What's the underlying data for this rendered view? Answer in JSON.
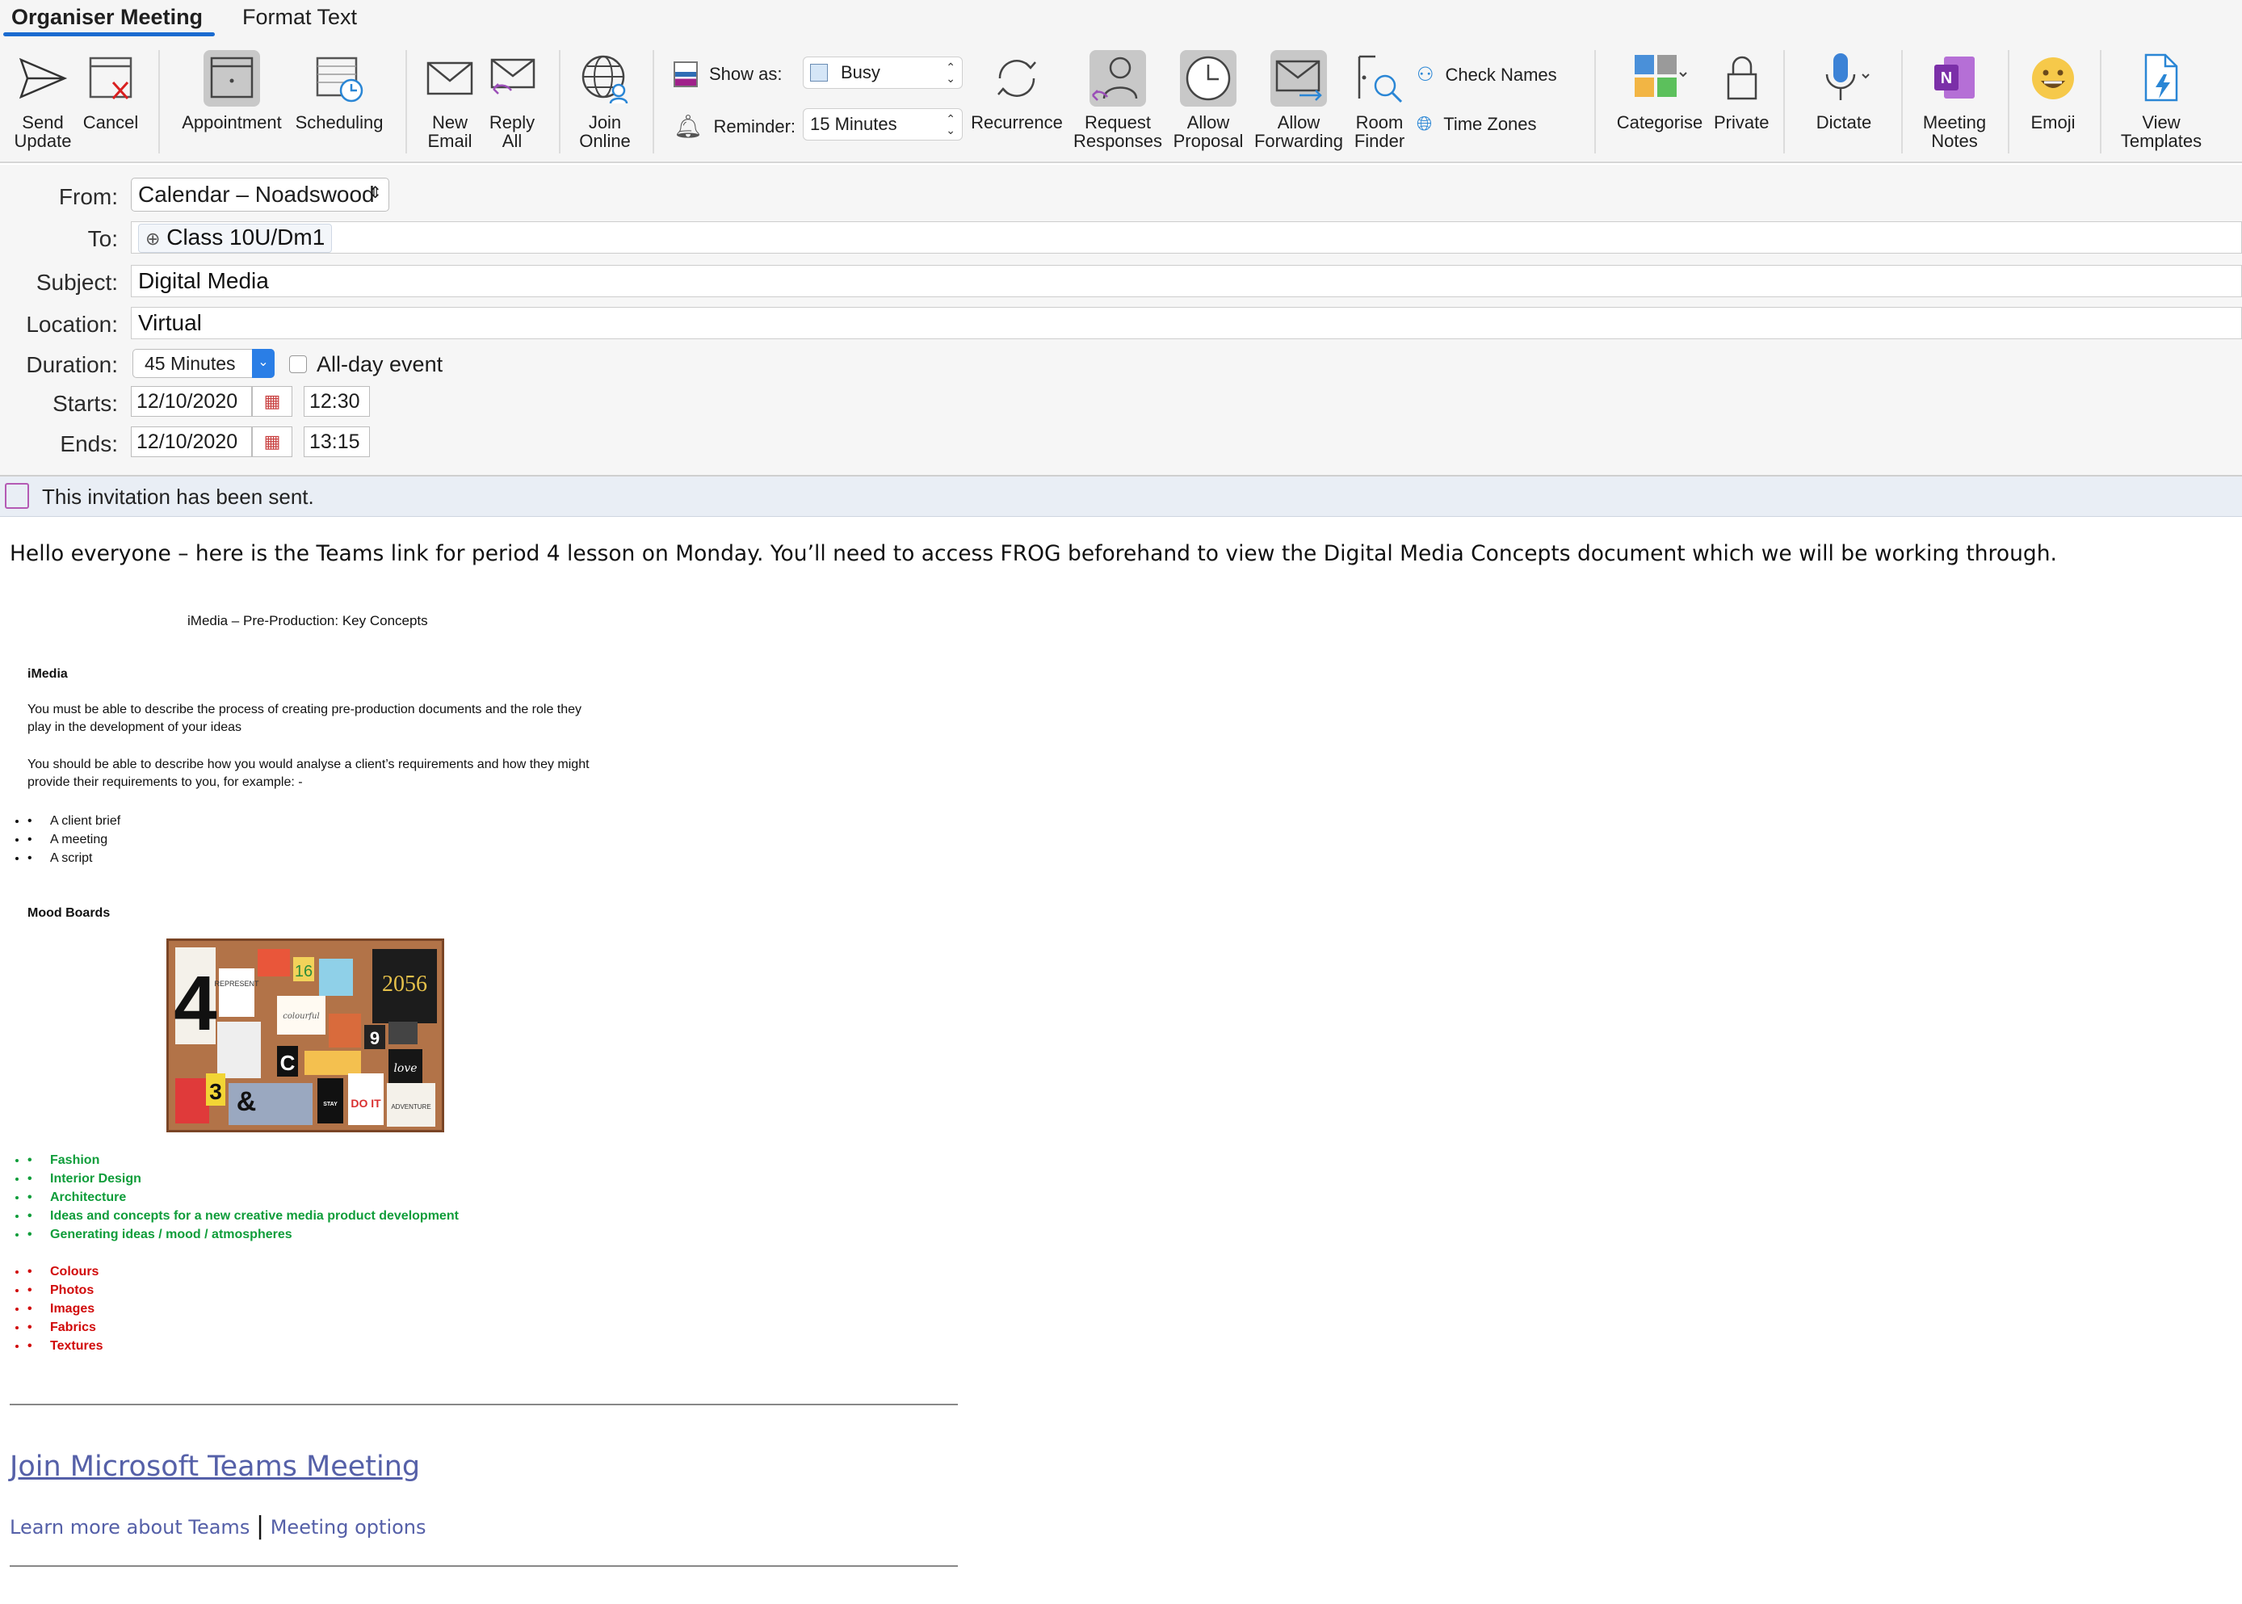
{
  "tabs": {
    "organiser": "Organiser Meeting",
    "format_text": "Format Text"
  },
  "ribbon": {
    "send_update": "Send\nUpdate",
    "cancel": "Cancel",
    "appointment": "Appointment",
    "scheduling": "Scheduling",
    "new_email": "New\nEmail",
    "reply_all": "Reply\nAll",
    "join_online": "Join\nOnline",
    "show_as_label": "Show as:",
    "show_as_value": "Busy",
    "reminder_label": "Reminder:",
    "reminder_value": "15 Minutes",
    "recurrence": "Recurrence",
    "request_responses": "Request\nResponses",
    "allow_proposal": "Allow\nProposal",
    "allow_forwarding": "Allow\nForwarding",
    "room_finder": "Room\nFinder",
    "check_names": "Check Names",
    "time_zones": "Time Zones",
    "categorise": "Categorise",
    "private": "Private",
    "dictate": "Dictate",
    "meeting_notes": "Meeting\nNotes",
    "emoji": "Emoji",
    "view_templates": "View\nTemplates"
  },
  "form": {
    "from_label": "From:",
    "from_value": "Calendar – Noadswood",
    "to_label": "To:",
    "to_value": "Class 10U/Dm1",
    "subject_label": "Subject:",
    "subject_value": "Digital Media",
    "location_label": "Location:",
    "location_value": "Virtual",
    "duration_label": "Duration:",
    "duration_value": "45 Minutes",
    "all_day_label": "All-day event",
    "starts_label": "Starts:",
    "starts_date": "12/10/2020",
    "starts_time": "12:30",
    "ends_label": "Ends:",
    "ends_date": "12/10/2020",
    "ends_time": "13:15"
  },
  "banner": {
    "text": "This invitation has been sent."
  },
  "body": {
    "intro": "Hello everyone – here is the Teams link for period 4 lesson on Monday. You’ll need to access FROG beforehand to view the Digital Media Concepts document which we will be working through.",
    "doc_title": "iMedia – Pre-Production: Key Concepts",
    "imedia_heading": "iMedia",
    "para1": "You must be able to describe the process of creating pre-production documents and the role they play in the development of your ideas",
    "para2": "You should be able to describe how you would analyse a client’s requirements and how they might provide their requirements to you, for example: -",
    "examples": [
      "A client brief",
      "A meeting",
      "A script"
    ],
    "mood_heading": "Mood Boards",
    "green_items": [
      "Fashion",
      "Interior Design",
      "Architecture",
      "Ideas and concepts for a new creative media product development",
      "Generating ideas / mood / atmospheres"
    ],
    "red_items": [
      "Colours",
      "Photos",
      "Images",
      "Fabrics",
      "Textures"
    ],
    "teams_link": "Join Microsoft Teams Meeting",
    "learn_more": "Learn more about Teams",
    "link_sep": "|",
    "meeting_options": "Meeting options"
  },
  "moodboard_text": [
    "4",
    "REPRESENT",
    "16",
    "2056",
    "colourful",
    "9",
    "C",
    "love",
    "3",
    "&",
    "DO IT",
    "ADVENTURE",
    "STAY"
  ],
  "colors": {
    "accent": "#1a6bd0",
    "onenote": "#7b2fa8",
    "green": "#0f9d3a",
    "red": "#d10a0a",
    "link": "#5560a8"
  }
}
